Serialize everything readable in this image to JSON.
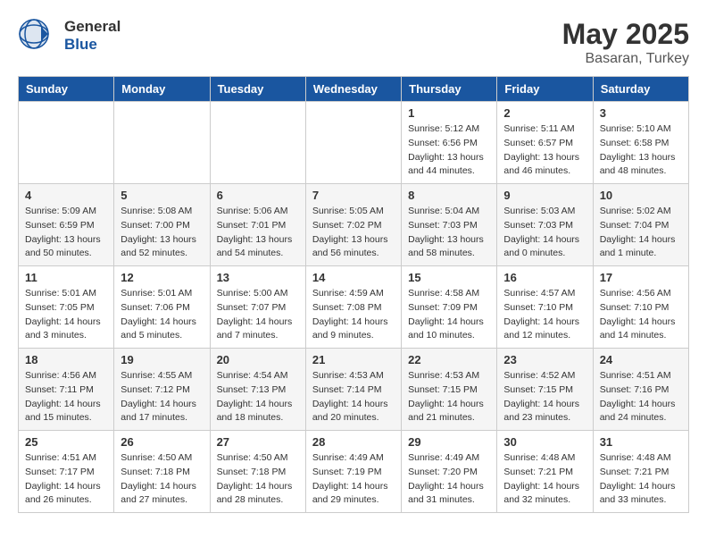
{
  "logo": {
    "general": "General",
    "blue": "Blue"
  },
  "title": "May 2025",
  "subtitle": "Basaran, Turkey",
  "weekdays": [
    "Sunday",
    "Monday",
    "Tuesday",
    "Wednesday",
    "Thursday",
    "Friday",
    "Saturday"
  ],
  "weeks": [
    [
      {
        "day": "",
        "info": ""
      },
      {
        "day": "",
        "info": ""
      },
      {
        "day": "",
        "info": ""
      },
      {
        "day": "",
        "info": ""
      },
      {
        "day": "1",
        "info": "Sunrise: 5:12 AM\nSunset: 6:56 PM\nDaylight: 13 hours\nand 44 minutes."
      },
      {
        "day": "2",
        "info": "Sunrise: 5:11 AM\nSunset: 6:57 PM\nDaylight: 13 hours\nand 46 minutes."
      },
      {
        "day": "3",
        "info": "Sunrise: 5:10 AM\nSunset: 6:58 PM\nDaylight: 13 hours\nand 48 minutes."
      }
    ],
    [
      {
        "day": "4",
        "info": "Sunrise: 5:09 AM\nSunset: 6:59 PM\nDaylight: 13 hours\nand 50 minutes."
      },
      {
        "day": "5",
        "info": "Sunrise: 5:08 AM\nSunset: 7:00 PM\nDaylight: 13 hours\nand 52 minutes."
      },
      {
        "day": "6",
        "info": "Sunrise: 5:06 AM\nSunset: 7:01 PM\nDaylight: 13 hours\nand 54 minutes."
      },
      {
        "day": "7",
        "info": "Sunrise: 5:05 AM\nSunset: 7:02 PM\nDaylight: 13 hours\nand 56 minutes."
      },
      {
        "day": "8",
        "info": "Sunrise: 5:04 AM\nSunset: 7:03 PM\nDaylight: 13 hours\nand 58 minutes."
      },
      {
        "day": "9",
        "info": "Sunrise: 5:03 AM\nSunset: 7:03 PM\nDaylight: 14 hours\nand 0 minutes."
      },
      {
        "day": "10",
        "info": "Sunrise: 5:02 AM\nSunset: 7:04 PM\nDaylight: 14 hours\nand 1 minute."
      }
    ],
    [
      {
        "day": "11",
        "info": "Sunrise: 5:01 AM\nSunset: 7:05 PM\nDaylight: 14 hours\nand 3 minutes."
      },
      {
        "day": "12",
        "info": "Sunrise: 5:01 AM\nSunset: 7:06 PM\nDaylight: 14 hours\nand 5 minutes."
      },
      {
        "day": "13",
        "info": "Sunrise: 5:00 AM\nSunset: 7:07 PM\nDaylight: 14 hours\nand 7 minutes."
      },
      {
        "day": "14",
        "info": "Sunrise: 4:59 AM\nSunset: 7:08 PM\nDaylight: 14 hours\nand 9 minutes."
      },
      {
        "day": "15",
        "info": "Sunrise: 4:58 AM\nSunset: 7:09 PM\nDaylight: 14 hours\nand 10 minutes."
      },
      {
        "day": "16",
        "info": "Sunrise: 4:57 AM\nSunset: 7:10 PM\nDaylight: 14 hours\nand 12 minutes."
      },
      {
        "day": "17",
        "info": "Sunrise: 4:56 AM\nSunset: 7:10 PM\nDaylight: 14 hours\nand 14 minutes."
      }
    ],
    [
      {
        "day": "18",
        "info": "Sunrise: 4:56 AM\nSunset: 7:11 PM\nDaylight: 14 hours\nand 15 minutes."
      },
      {
        "day": "19",
        "info": "Sunrise: 4:55 AM\nSunset: 7:12 PM\nDaylight: 14 hours\nand 17 minutes."
      },
      {
        "day": "20",
        "info": "Sunrise: 4:54 AM\nSunset: 7:13 PM\nDaylight: 14 hours\nand 18 minutes."
      },
      {
        "day": "21",
        "info": "Sunrise: 4:53 AM\nSunset: 7:14 PM\nDaylight: 14 hours\nand 20 minutes."
      },
      {
        "day": "22",
        "info": "Sunrise: 4:53 AM\nSunset: 7:15 PM\nDaylight: 14 hours\nand 21 minutes."
      },
      {
        "day": "23",
        "info": "Sunrise: 4:52 AM\nSunset: 7:15 PM\nDaylight: 14 hours\nand 23 minutes."
      },
      {
        "day": "24",
        "info": "Sunrise: 4:51 AM\nSunset: 7:16 PM\nDaylight: 14 hours\nand 24 minutes."
      }
    ],
    [
      {
        "day": "25",
        "info": "Sunrise: 4:51 AM\nSunset: 7:17 PM\nDaylight: 14 hours\nand 26 minutes."
      },
      {
        "day": "26",
        "info": "Sunrise: 4:50 AM\nSunset: 7:18 PM\nDaylight: 14 hours\nand 27 minutes."
      },
      {
        "day": "27",
        "info": "Sunrise: 4:50 AM\nSunset: 7:18 PM\nDaylight: 14 hours\nand 28 minutes."
      },
      {
        "day": "28",
        "info": "Sunrise: 4:49 AM\nSunset: 7:19 PM\nDaylight: 14 hours\nand 29 minutes."
      },
      {
        "day": "29",
        "info": "Sunrise: 4:49 AM\nSunset: 7:20 PM\nDaylight: 14 hours\nand 31 minutes."
      },
      {
        "day": "30",
        "info": "Sunrise: 4:48 AM\nSunset: 7:21 PM\nDaylight: 14 hours\nand 32 minutes."
      },
      {
        "day": "31",
        "info": "Sunrise: 4:48 AM\nSunset: 7:21 PM\nDaylight: 14 hours\nand 33 minutes."
      }
    ]
  ]
}
